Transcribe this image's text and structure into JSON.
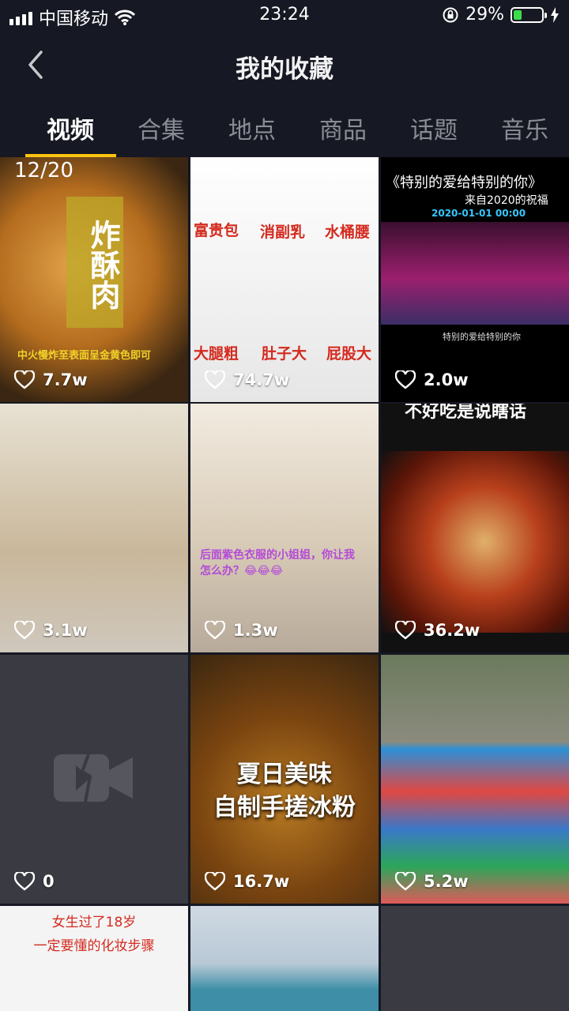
{
  "status_bar": {
    "carrier": "中国移动",
    "time": "23:24",
    "battery_percent": "29%",
    "battery_level": 0.29,
    "colors": {
      "battery_fill": "#3ddc4b"
    }
  },
  "header": {
    "title": "我的收藏",
    "back_icon": "chevron-left-icon"
  },
  "tabs": [
    {
      "label": "视频",
      "active": true
    },
    {
      "label": "合集",
      "active": false
    },
    {
      "label": "地点",
      "active": false
    },
    {
      "label": "商品",
      "active": false
    },
    {
      "label": "话题",
      "active": false
    },
    {
      "label": "音乐",
      "active": false
    }
  ],
  "accent_color": "#fcc412",
  "videos": [
    {
      "likes": "7.7w",
      "overlay": [
        "12/20",
        "炸酥肉",
        "中火慢炸至表面呈金黄色即可"
      ]
    },
    {
      "likes": "74.7w",
      "overlay": [
        "富贵包",
        "消副乳",
        "水桶腰",
        "大腿粗",
        "肚子大",
        "屁股大"
      ]
    },
    {
      "likes": "2.0w",
      "overlay": [
        "《特别的爱给特别的你》",
        "来自2020的祝福",
        "2020-01-01 00:00",
        "特别的爱给特别的你"
      ]
    },
    {
      "likes": "3.1w",
      "overlay": []
    },
    {
      "likes": "1.3w",
      "overlay": [
        "后面紫色衣服的小姐姐，你让我怎么办？😂😂😂"
      ]
    },
    {
      "likes": "36.2w",
      "overlay": [
        "不好吃是说瞎话"
      ]
    },
    {
      "likes": "0",
      "overlay": []
    },
    {
      "likes": "16.7w",
      "overlay": [
        "夏日美味",
        "自制手搓冰粉"
      ]
    },
    {
      "likes": "5.2w",
      "overlay": []
    },
    {
      "likes": "",
      "overlay": [
        "女生过了18岁",
        "一定要懂的化妆步骤"
      ]
    },
    {
      "likes": "",
      "overlay": []
    },
    {
      "likes": "",
      "overlay": []
    }
  ]
}
